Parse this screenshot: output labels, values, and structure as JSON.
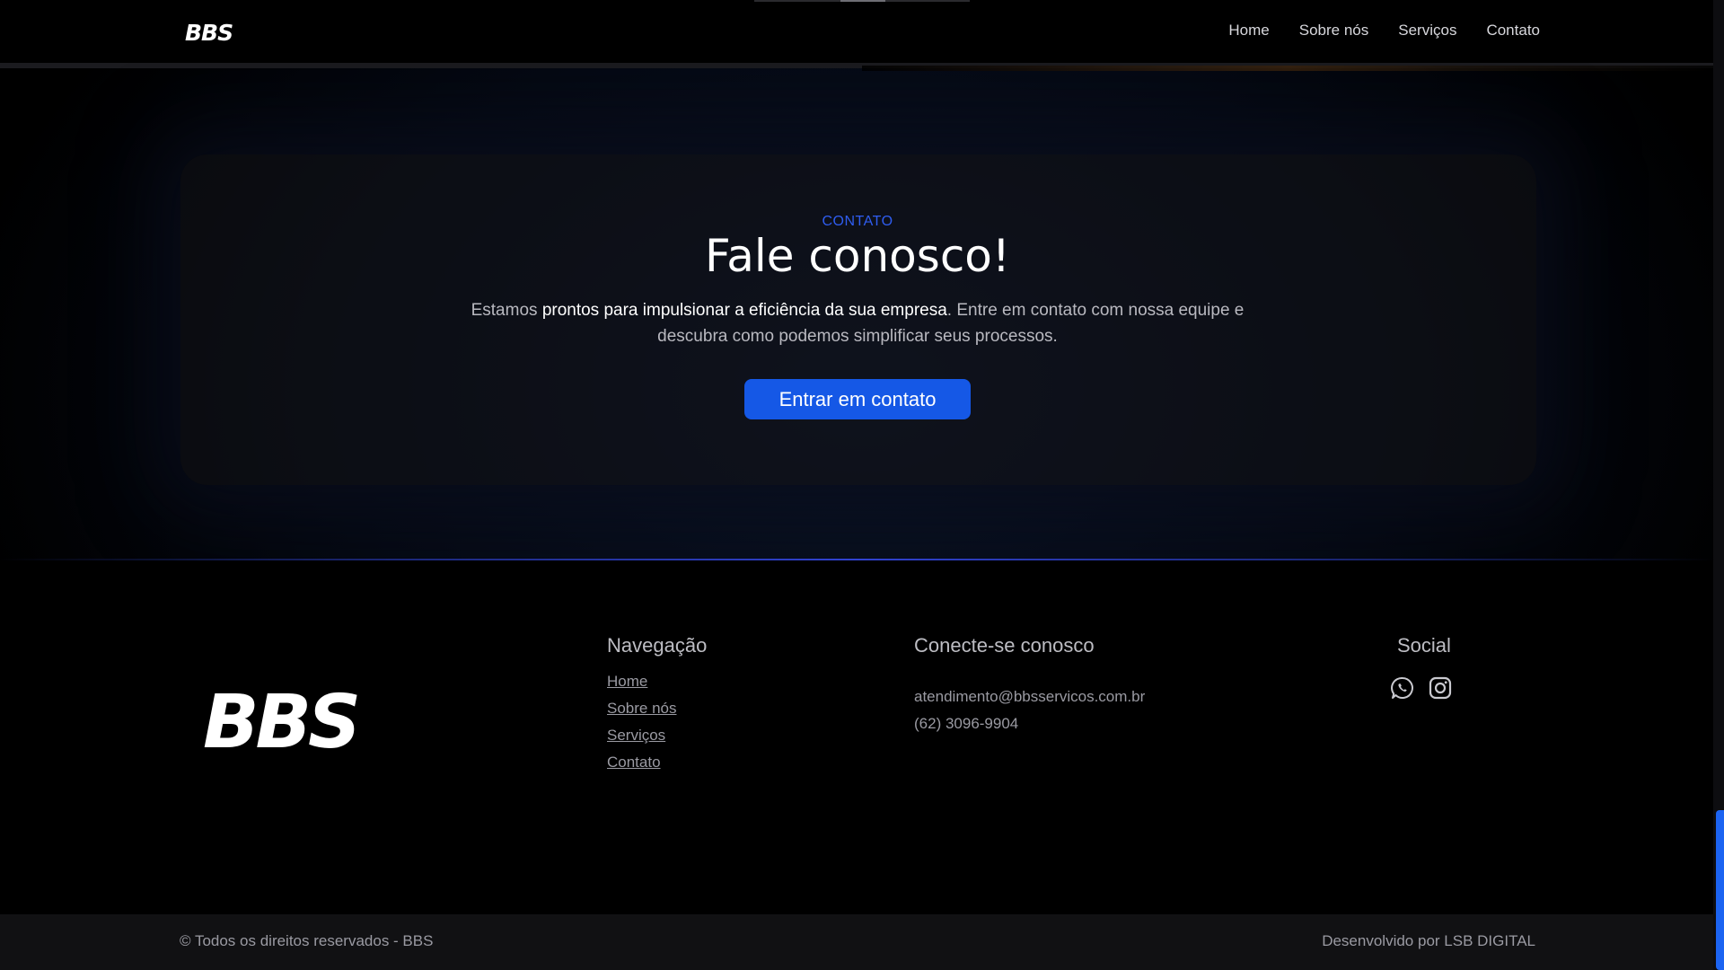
{
  "header": {
    "logo_text": "BBS",
    "nav": [
      {
        "label": "Home"
      },
      {
        "label": "Sobre nós"
      },
      {
        "label": "Serviços"
      },
      {
        "label": "Contato"
      }
    ]
  },
  "contact_section": {
    "eyebrow": "CONTATO",
    "title": "Fale conosco!",
    "description_part1": "Estamos ",
    "description_highlight": "prontos para impulsionar a eficiência da sua empresa",
    "description_part2": ". Entre em contato com nossa equipe e descubra como podemos simplificar seus processos.",
    "cta_label": "Entrar em contato"
  },
  "footer": {
    "logo_text": "BBS",
    "navigation_title": "Navegação",
    "navigation_links": [
      {
        "label": "Home"
      },
      {
        "label": "Sobre nós"
      },
      {
        "label": "Serviços"
      },
      {
        "label": "Contato"
      }
    ],
    "contact_title": "Conecte-se conosco",
    "email": "atendimento@bbsservicos.com.br",
    "phone": "(62) 3096-9904",
    "social_title": "Social",
    "social_icons": [
      "whatsapp-icon",
      "instagram-icon"
    ]
  },
  "bottom_bar": {
    "copyright": "© Todos os direitos reservados - BBS",
    "credits": "Desenvolvido por LSB DIGITAL"
  },
  "colors": {
    "accent": "#1558e6",
    "eyebrow": "#2f5df0",
    "scroll_thumb": "#1c64f2"
  }
}
